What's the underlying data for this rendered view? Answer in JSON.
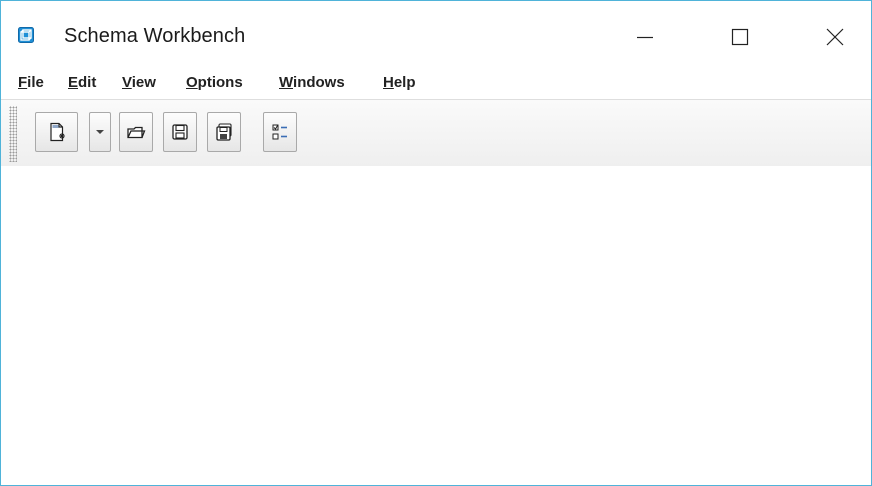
{
  "window": {
    "title": "Schema Workbench",
    "icon": "cube-icon",
    "accent_color": "#4fb3d9"
  },
  "menu": {
    "items": [
      {
        "mnemonic": "F",
        "rest": "ile"
      },
      {
        "mnemonic": "E",
        "rest": "dit"
      },
      {
        "mnemonic": "V",
        "rest": "iew"
      },
      {
        "mnemonic": "O",
        "rest": "ptions"
      },
      {
        "mnemonic": "W",
        "rest": "indows"
      },
      {
        "mnemonic": "H",
        "rest": "elp"
      }
    ]
  },
  "toolbar": {
    "buttons": [
      {
        "icon": "new-file-icon"
      },
      {
        "icon": "chevron-down-icon"
      },
      {
        "icon": "open-folder-icon"
      },
      {
        "icon": "save-icon"
      },
      {
        "icon": "save-as-icon"
      },
      {
        "icon": "list-icon"
      }
    ]
  }
}
